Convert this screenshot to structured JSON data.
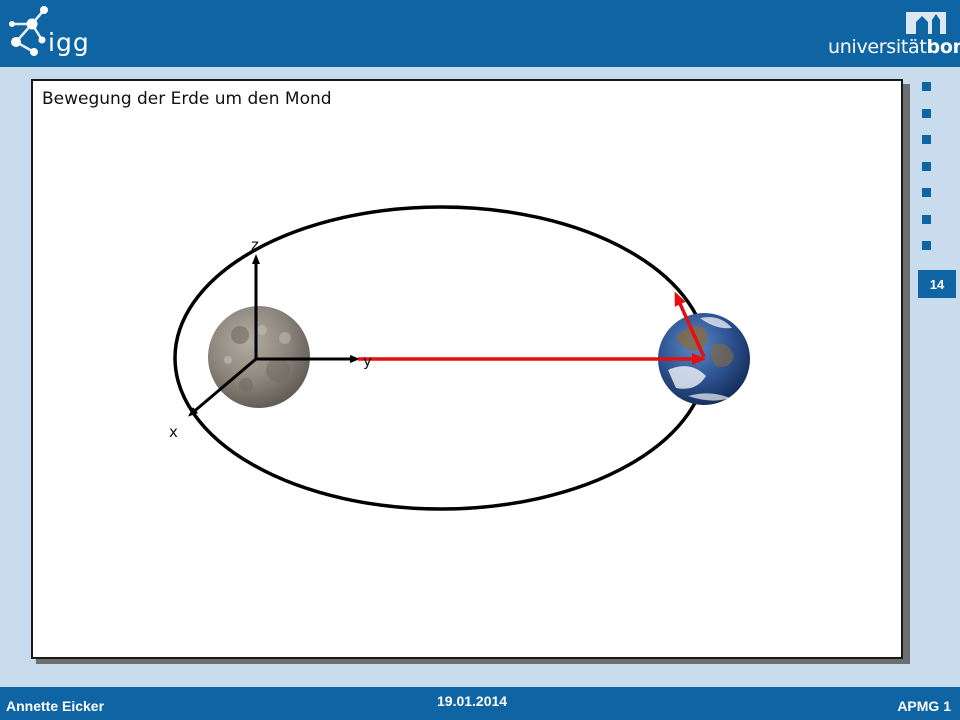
{
  "header": {
    "institute_logo_text": "igg",
    "university_logo_text_prefix": "universität",
    "university_logo_text_suffix": "bonn"
  },
  "sidebar": {
    "bullet_count": 7,
    "page_number": "14"
  },
  "slide": {
    "title": "Bewegung der Erde um den Mond",
    "axis_labels": {
      "z": "z",
      "y": "y",
      "x": "x"
    }
  },
  "footer": {
    "author": "Annette Eicker",
    "date": "19.01.2014",
    "course": "APMG 1"
  },
  "colors": {
    "brand_blue": "#0f64a3",
    "background": "#c8dced",
    "vector_red": "#e41010",
    "orbit_black": "#000000"
  }
}
